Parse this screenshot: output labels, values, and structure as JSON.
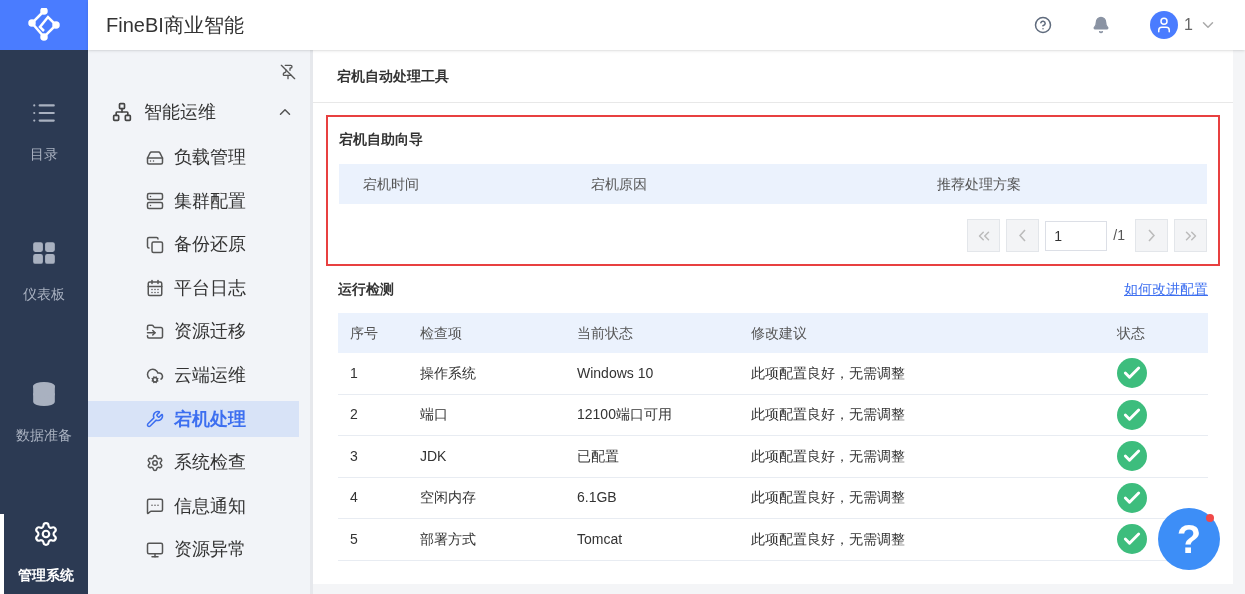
{
  "app": {
    "title": "FineBI商业智能"
  },
  "header": {
    "user": "1"
  },
  "rail": [
    {
      "label": "目录",
      "selected": false
    },
    {
      "label": "仪表板",
      "selected": false
    },
    {
      "label": "数据准备",
      "selected": false
    },
    {
      "label": "管理系统",
      "selected": true
    }
  ],
  "nav": {
    "group": "智能运维",
    "expanded": true,
    "items": [
      {
        "label": "负载管理",
        "selected": false
      },
      {
        "label": "集群配置",
        "selected": false
      },
      {
        "label": "备份还原",
        "selected": false
      },
      {
        "label": "平台日志",
        "selected": false
      },
      {
        "label": "资源迁移",
        "selected": false
      },
      {
        "label": "云端运维",
        "selected": false
      },
      {
        "label": "宕机处理",
        "selected": true
      },
      {
        "label": "系统检查",
        "selected": false
      },
      {
        "label": "信息通知",
        "selected": false
      },
      {
        "label": "资源异常",
        "selected": false
      }
    ]
  },
  "page": {
    "title": "宕机自动处理工具"
  },
  "guide": {
    "title": "宕机自助向导",
    "highlighted": true,
    "columns": [
      "宕机时间",
      "宕机原因",
      "推荐处理方案"
    ],
    "page_input": "1",
    "page_total": "/1"
  },
  "check": {
    "title": "运行检测",
    "link": "如何改进配置",
    "columns": [
      "序号",
      "检查项",
      "当前状态",
      "修改建议",
      "状态"
    ],
    "rows": [
      {
        "cells": [
          "1",
          "操作系统",
          "Windows 10",
          "此项配置良好，无需调整"
        ],
        "ok": true
      },
      {
        "cells": [
          "2",
          "端口",
          "12100端口可用",
          "此项配置良好，无需调整"
        ],
        "ok": true
      },
      {
        "cells": [
          "3",
          "JDK",
          "已配置",
          "此项配置良好，无需调整"
        ],
        "ok": true
      },
      {
        "cells": [
          "4",
          "空闲内存",
          "6.1GB",
          "此项配置良好，无需调整"
        ],
        "ok": true
      },
      {
        "cells": [
          "5",
          "部署方式",
          "Tomcat",
          "此项配置良好，无需调整"
        ],
        "ok": true
      }
    ]
  },
  "help_fab": {
    "label": "?"
  }
}
